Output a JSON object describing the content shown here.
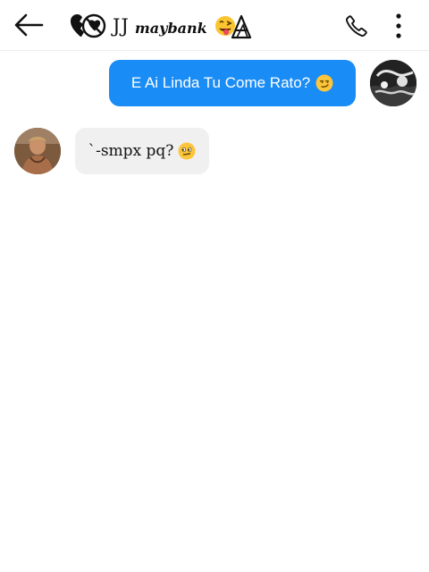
{
  "header": {
    "title_prefix": "JJ",
    "title_name": "maybank",
    "back_icon": "arrow-left-icon",
    "call_icon": "phone-icon",
    "more_icon": "more-vertical-icon"
  },
  "messages": [
    {
      "direction": "outgoing",
      "text": "E Ai Linda Tu Come Rato?",
      "emoji": "smirk-face"
    },
    {
      "direction": "incoming",
      "text": "`-smpx pq?",
      "emoji": "side-eye-face"
    }
  ],
  "colors": {
    "outgoing_bubble": "#1a8cf5",
    "incoming_bubble": "#f0f0f0",
    "header_border": "#ececec"
  }
}
